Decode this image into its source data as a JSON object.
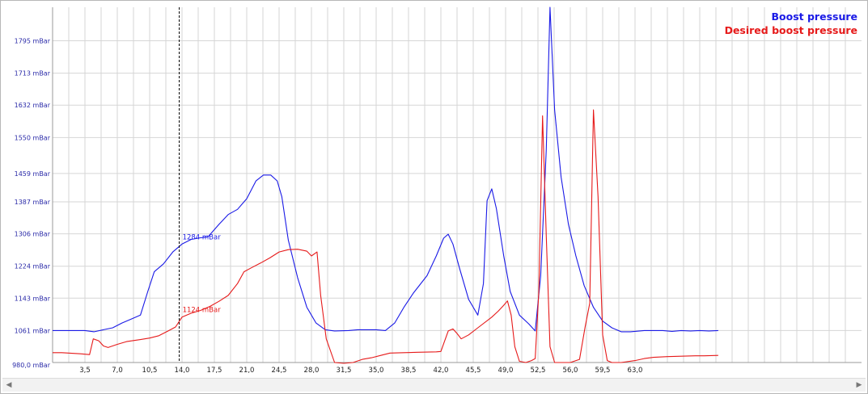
{
  "chart_data": {
    "type": "line",
    "y_ticks": [
      {
        "value": 980,
        "label": "980,0 mBar"
      },
      {
        "value": 1061,
        "label": "1061 mBar"
      },
      {
        "value": 1143,
        "label": "1143 mBar"
      },
      {
        "value": 1224,
        "label": "1224 mBar"
      },
      {
        "value": 1306,
        "label": "1306 mBar"
      },
      {
        "value": 1387,
        "label": "1387 mBar"
      },
      {
        "value": 1459,
        "label": "1459 mBar"
      },
      {
        "value": 1550,
        "label": "1550 mBar"
      },
      {
        "value": 1632,
        "label": "1632 mBar"
      },
      {
        "value": 1713,
        "label": "1713 mBar"
      },
      {
        "value": 1795,
        "label": "1795 mBar"
      }
    ],
    "x_ticks": [
      {
        "value": 3.5,
        "label": "3,5"
      },
      {
        "value": 7.0,
        "label": "7,0"
      },
      {
        "value": 10.5,
        "label": "10,5"
      },
      {
        "value": 14.0,
        "label": "14,0"
      },
      {
        "value": 17.5,
        "label": "17,5"
      },
      {
        "value": 21.0,
        "label": "21,0"
      },
      {
        "value": 24.5,
        "label": "24,5"
      },
      {
        "value": 28.0,
        "label": "28,0"
      },
      {
        "value": 31.5,
        "label": "31,5"
      },
      {
        "value": 35.0,
        "label": "35,0"
      },
      {
        "value": 38.5,
        "label": "38,5"
      },
      {
        "value": 42.0,
        "label": "42,0"
      },
      {
        "value": 45.5,
        "label": "45,5"
      },
      {
        "value": 49.0,
        "label": "49,0"
      },
      {
        "value": 52.5,
        "label": "52,5"
      },
      {
        "value": 56.0,
        "label": "56,0"
      },
      {
        "value": 59.5,
        "label": "59,5"
      },
      {
        "value": 63.0,
        "label": "63,0"
      }
    ],
    "xlim": [
      0,
      87.5
    ],
    "ylim": [
      980,
      1880
    ],
    "grid": true,
    "legend_position": "top-right",
    "cursor": {
      "x": 13.7,
      "labels": [
        {
          "series": "Boost pressure",
          "text": "1284 mBar"
        },
        {
          "series": "Desired boost pressure",
          "text": "1124 mBar"
        }
      ]
    },
    "series": [
      {
        "name": "Boost pressure",
        "color": "#1a1ae6",
        "points": [
          [
            0,
            1061
          ],
          [
            3.5,
            1061
          ],
          [
            4.5,
            1058
          ],
          [
            5.5,
            1063
          ],
          [
            6.5,
            1068
          ],
          [
            7.5,
            1080
          ],
          [
            8.5,
            1090
          ],
          [
            9.5,
            1100
          ],
          [
            10.3,
            1160
          ],
          [
            11.0,
            1210
          ],
          [
            12.0,
            1230
          ],
          [
            13.0,
            1260
          ],
          [
            14.0,
            1280
          ],
          [
            15.0,
            1292
          ],
          [
            16.0,
            1296
          ],
          [
            16.8,
            1298
          ],
          [
            18.0,
            1330
          ],
          [
            19.0,
            1355
          ],
          [
            20.0,
            1368
          ],
          [
            21.0,
            1395
          ],
          [
            22.0,
            1440
          ],
          [
            22.8,
            1455
          ],
          [
            23.6,
            1455
          ],
          [
            24.3,
            1440
          ],
          [
            24.8,
            1400
          ],
          [
            25.5,
            1290
          ],
          [
            26.5,
            1195
          ],
          [
            27.5,
            1120
          ],
          [
            28.5,
            1080
          ],
          [
            29.5,
            1063
          ],
          [
            30.5,
            1060
          ],
          [
            32.0,
            1061
          ],
          [
            33.0,
            1063
          ],
          [
            35.0,
            1063
          ],
          [
            36.0,
            1061
          ],
          [
            37.0,
            1080
          ],
          [
            38.0,
            1120
          ],
          [
            39.0,
            1155
          ],
          [
            40.5,
            1200
          ],
          [
            41.5,
            1250
          ],
          [
            42.3,
            1295
          ],
          [
            42.8,
            1305
          ],
          [
            43.3,
            1280
          ],
          [
            44.0,
            1220
          ],
          [
            45.0,
            1140
          ],
          [
            46.0,
            1100
          ],
          [
            46.6,
            1180
          ],
          [
            47.0,
            1390
          ],
          [
            47.5,
            1420
          ],
          [
            48.0,
            1370
          ],
          [
            48.8,
            1250
          ],
          [
            49.5,
            1160
          ],
          [
            50.5,
            1100
          ],
          [
            51.5,
            1078
          ],
          [
            52.2,
            1060
          ],
          [
            52.8,
            1200
          ],
          [
            53.4,
            1520
          ],
          [
            53.8,
            1880
          ],
          [
            54.3,
            1620
          ],
          [
            55.0,
            1450
          ],
          [
            55.8,
            1330
          ],
          [
            56.6,
            1250
          ],
          [
            57.5,
            1175
          ],
          [
            58.5,
            1120
          ],
          [
            59.5,
            1085
          ],
          [
            60.5,
            1068
          ],
          [
            61.5,
            1058
          ],
          [
            62.5,
            1058
          ],
          [
            64.0,
            1061
          ],
          [
            66.0,
            1061
          ],
          [
            67.0,
            1059
          ],
          [
            68.0,
            1061
          ],
          [
            69.0,
            1060
          ],
          [
            70.0,
            1061
          ],
          [
            71.0,
            1060
          ],
          [
            72.0,
            1061
          ]
        ]
      },
      {
        "name": "Desired boost pressure",
        "color": "#e61a1a",
        "points": [
          [
            0,
            1005
          ],
          [
            1.0,
            1005
          ],
          [
            3.0,
            1002
          ],
          [
            4.0,
            1000
          ],
          [
            4.4,
            1040
          ],
          [
            5.0,
            1035
          ],
          [
            5.5,
            1022
          ],
          [
            6.0,
            1018
          ],
          [
            7.0,
            1026
          ],
          [
            8.0,
            1033
          ],
          [
            9.5,
            1038
          ],
          [
            10.5,
            1042
          ],
          [
            11.5,
            1048
          ],
          [
            12.5,
            1060
          ],
          [
            13.3,
            1070
          ],
          [
            14.0,
            1095
          ],
          [
            15.0,
            1105
          ],
          [
            16.0,
            1112
          ],
          [
            17.0,
            1122
          ],
          [
            18.0,
            1135
          ],
          [
            19.0,
            1150
          ],
          [
            20.0,
            1180
          ],
          [
            20.7,
            1210
          ],
          [
            21.5,
            1220
          ],
          [
            22.5,
            1232
          ],
          [
            23.5,
            1245
          ],
          [
            24.5,
            1260
          ],
          [
            25.5,
            1266
          ],
          [
            26.5,
            1267
          ],
          [
            27.5,
            1262
          ],
          [
            28.0,
            1250
          ],
          [
            28.6,
            1260
          ],
          [
            29.0,
            1150
          ],
          [
            29.6,
            1040
          ],
          [
            30.5,
            980
          ],
          [
            31.5,
            978
          ],
          [
            32.5,
            980
          ],
          [
            33.5,
            988
          ],
          [
            34.5,
            992
          ],
          [
            35.5,
            998
          ],
          [
            36.5,
            1004
          ],
          [
            38.0,
            1005
          ],
          [
            39.5,
            1006
          ],
          [
            41.5,
            1007
          ],
          [
            42.0,
            1008
          ],
          [
            42.8,
            1060
          ],
          [
            43.3,
            1065
          ],
          [
            43.8,
            1052
          ],
          [
            44.2,
            1040
          ],
          [
            45.0,
            1050
          ],
          [
            46.0,
            1068
          ],
          [
            47.5,
            1095
          ],
          [
            48.2,
            1110
          ],
          [
            48.8,
            1125
          ],
          [
            49.2,
            1136
          ],
          [
            49.6,
            1100
          ],
          [
            50.0,
            1020
          ],
          [
            50.5,
            983
          ],
          [
            51.2,
            980
          ],
          [
            51.8,
            985
          ],
          [
            52.2,
            990
          ],
          [
            52.6,
            1160
          ],
          [
            53.0,
            1605
          ],
          [
            53.4,
            1300
          ],
          [
            53.8,
            1020
          ],
          [
            54.3,
            980
          ],
          [
            55.0,
            980
          ],
          [
            56.0,
            980
          ],
          [
            57.0,
            988
          ],
          [
            57.6,
            1070
          ],
          [
            58.1,
            1130
          ],
          [
            58.5,
            1620
          ],
          [
            59.0,
            1400
          ],
          [
            59.5,
            1050
          ],
          [
            60.0,
            985
          ],
          [
            60.5,
            980
          ],
          [
            61.5,
            980
          ],
          [
            63.0,
            985
          ],
          [
            64.0,
            990
          ],
          [
            65.0,
            993
          ],
          [
            66.5,
            995
          ],
          [
            68.0,
            996
          ],
          [
            69.5,
            997
          ],
          [
            70.5,
            997
          ],
          [
            72.0,
            998
          ]
        ]
      }
    ]
  },
  "scrollbar": {
    "left_arrow": "◀",
    "right_arrow": "▶"
  }
}
